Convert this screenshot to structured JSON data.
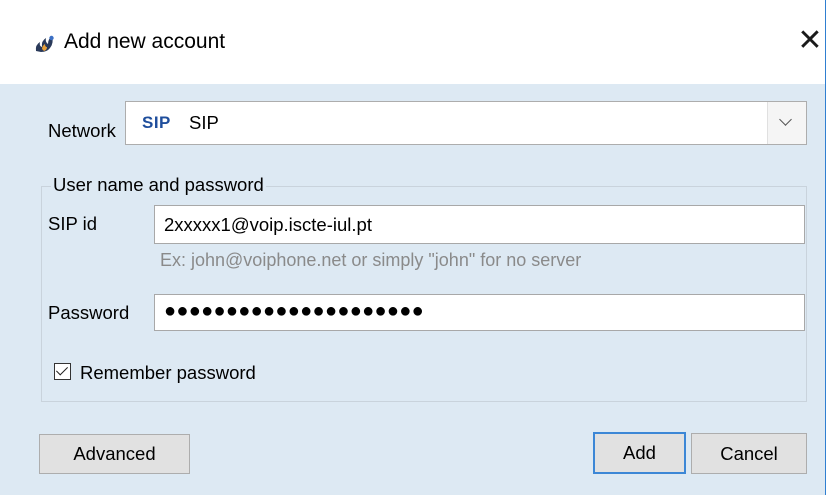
{
  "window": {
    "title": "Add new account",
    "title_icon": "flame-app-icon",
    "close_glyph": "✕"
  },
  "network": {
    "label": "Network",
    "logo_text": "SIP",
    "selected_value": "SIP",
    "options": [
      "SIP"
    ]
  },
  "credentials": {
    "group_label": "User name and password",
    "sip_id_label": "SIP id",
    "sip_id_value": "2xxxxx1@voip.iscte-iul.pt",
    "sip_id_hint": "Ex: john@voiphone.net or simply \"john\" for no server",
    "password_label": "Password",
    "password_value": "●●●●●●●●●●●●●●●●●●●●●",
    "remember_label": "Remember password",
    "remember_checked": true
  },
  "buttons": {
    "advanced": "Advanced",
    "add": "Add",
    "cancel": "Cancel"
  },
  "colors": {
    "client_background": "#dde9f3",
    "accent_border": "#3c87d6",
    "sip_logo": "#1f4e9c",
    "hint_text": "#8a8a8a"
  }
}
